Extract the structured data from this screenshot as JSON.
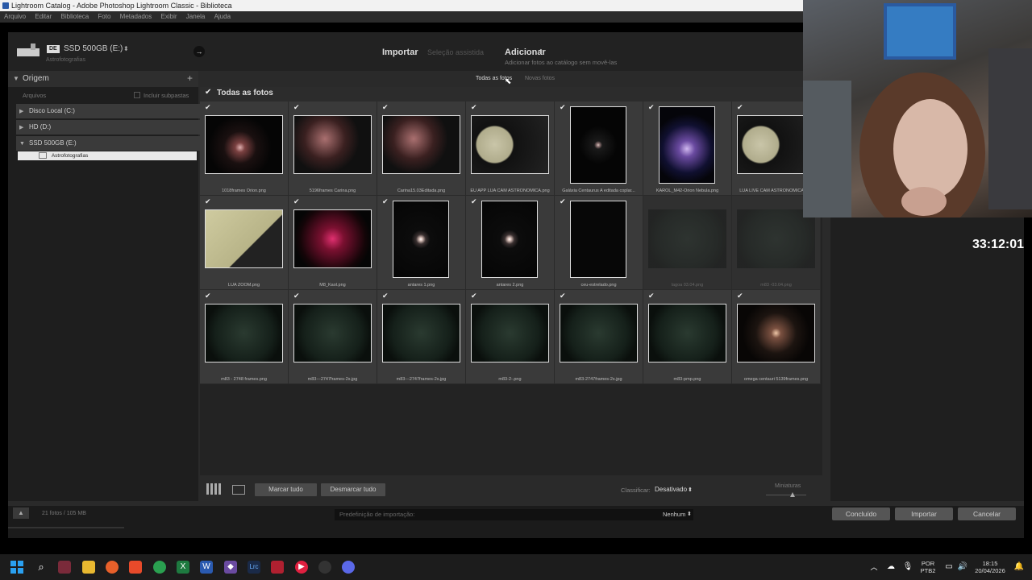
{
  "window": {
    "title": "Lightroom Catalog - Adobe Photoshop Lightroom Classic - Biblioteca",
    "menu": [
      "Arquivo",
      "Editar",
      "Biblioteca",
      "Foto",
      "Metadados",
      "Exibir",
      "Janela",
      "Ajuda"
    ]
  },
  "header": {
    "source_badge": "DE",
    "source_name": "SSD 500GB (E:)",
    "source_path": "Astrofotografias",
    "mode_import": "Importar",
    "mode_assisted": "Seleção assistida",
    "mode_add": "Adicionar",
    "mode_add_desc": "Adicionar fotos ao catálogo sem movê-las"
  },
  "left_panel": {
    "title": "Origem",
    "files_label": "Arquivos",
    "include_subfolders": "Incluir subpastas",
    "volumes": [
      "Disco Local (C:)",
      "HD (D:)",
      "SSD 500GB (E:)"
    ],
    "folder": "Astrofotografias",
    "status": "21 fotos / 105 MB"
  },
  "grid": {
    "tab_all": "Todas as fotos",
    "tab_new": "Novas fotos",
    "section_title": "Todas as fotos",
    "photos": [
      {
        "name": "1018frames Orion.png",
        "style": "nebula-thumb",
        "checked": true,
        "dim": false
      },
      {
        "name": "5196frames Carina.png",
        "style": "carina-thumb",
        "checked": true,
        "dim": false
      },
      {
        "name": "Carina15.03Editada.png",
        "style": "carina-thumb",
        "checked": true,
        "dim": false
      },
      {
        "name": "EU APP LUA CAM ASTRONOMICA.png",
        "style": "moon-thumb",
        "checked": true,
        "dim": false
      },
      {
        "name": "Galáxia Centaurus A editada coplar...",
        "style": "star-thumb",
        "checked": true,
        "dim": false
      },
      {
        "name": "KAROL_M42-Orion Nebula.png",
        "style": "orion-thumb",
        "checked": true,
        "dim": false
      },
      {
        "name": "LUA LIVE CAM ASTRONOMICA.png",
        "style": "moon-thumb",
        "checked": true,
        "dim": false
      },
      {
        "name": "LUA ZOOM.png",
        "style": "moonzoom-thumb",
        "checked": true,
        "dim": false
      },
      {
        "name": "M8_Kaol.png",
        "style": "m8-thumb",
        "checked": true,
        "dim": false
      },
      {
        "name": "antares 1.png",
        "style": "spike-thumb",
        "checked": true,
        "dim": false
      },
      {
        "name": "antares 2.png",
        "style": "spike-thumb",
        "checked": true,
        "dim": false
      },
      {
        "name": "ceu-estrelado.png",
        "style": "dark-thumb",
        "checked": true,
        "dim": false
      },
      {
        "name": "lagoa 03.04.png",
        "style": "green-thumb",
        "checked": false,
        "dim": true
      },
      {
        "name": "m83 -03.04.png",
        "style": "green-thumb",
        "checked": false,
        "dim": true
      },
      {
        "name": "m83 - 2748 frames.png",
        "style": "green-thumb",
        "checked": true,
        "dim": false
      },
      {
        "name": "m83---2747frames-2s.jpg",
        "style": "green-thumb",
        "checked": true,
        "dim": false
      },
      {
        "name": "m83---2747frames-2s.jpg",
        "style": "green-thumb",
        "checked": true,
        "dim": false
      },
      {
        "name": "m83-2-.png",
        "style": "green-thumb",
        "checked": true,
        "dim": false
      },
      {
        "name": "m83-2747frames-2s.jpg",
        "style": "green-thumb",
        "checked": true,
        "dim": false
      },
      {
        "name": "m83-pmp.png",
        "style": "green-thumb",
        "checked": true,
        "dim": false
      },
      {
        "name": "omega centauri 5139frames.png",
        "style": "omega-thumb",
        "checked": true,
        "dim": false
      }
    ]
  },
  "bottom_toolbar": {
    "check_all": "Marcar tudo",
    "uncheck_all": "Desmarcar tudo",
    "sort_label": "Classificar:",
    "sort_value": "Desativado",
    "thumbs_label": "Miniaturas"
  },
  "footer": {
    "preset_label": "Predefinição de importação:",
    "preset_value": "Nenhum",
    "done": "Concluído",
    "import": "Importar",
    "cancel": "Cancelar"
  },
  "overlay": {
    "timer": "33:12:01"
  },
  "taskbar": {
    "lang_line1": "POR",
    "lang_line2": "PTB2",
    "time": "18:15",
    "date": "20/04/2026"
  }
}
